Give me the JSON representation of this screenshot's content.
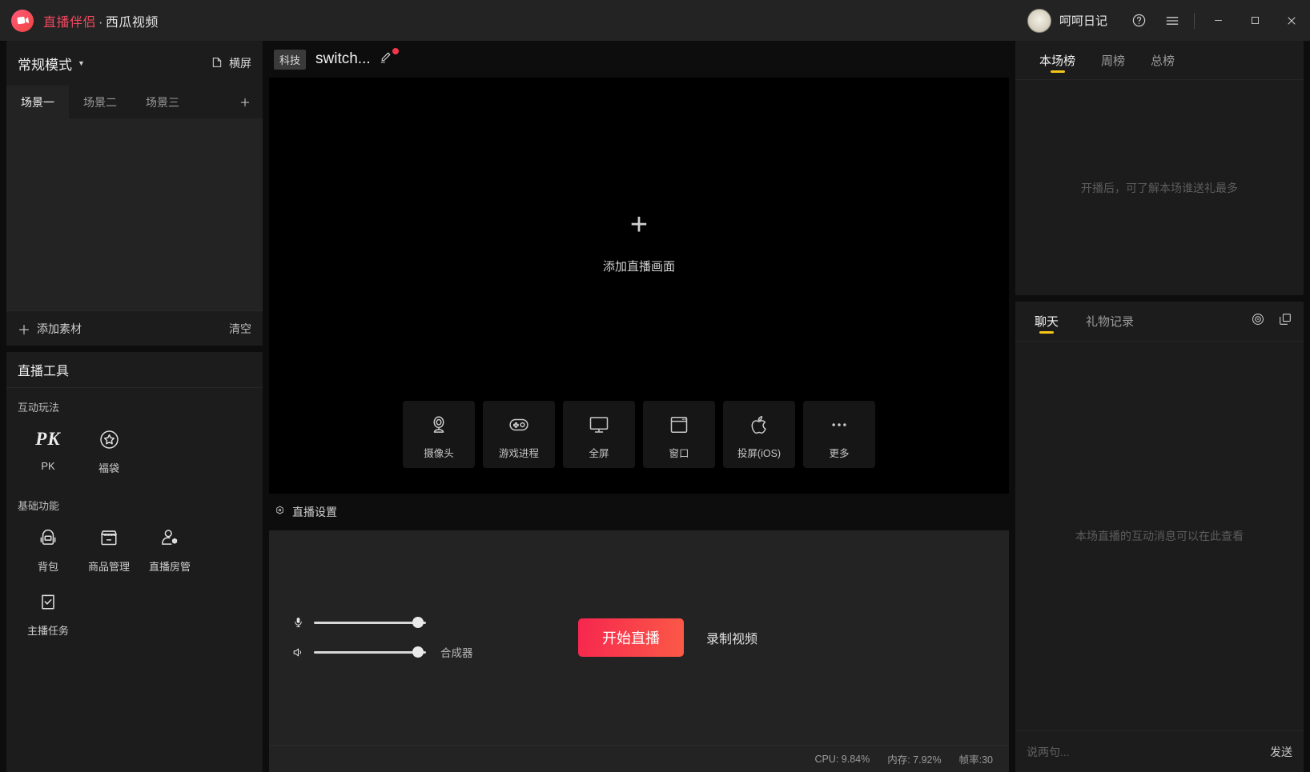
{
  "titlebar": {
    "brand": "直播伴侣",
    "separator": "·",
    "product": "西瓜视频",
    "username": "呵呵日记",
    "help_icon": "help-circle-icon",
    "menu_icon": "hamburger-menu-icon",
    "minimize_icon": "minimize-icon",
    "maximize_icon": "maximize-icon",
    "close_icon": "close-icon",
    "logo_bg": "#f2485e"
  },
  "left_panel": {
    "mode_label": "常规模式",
    "orientation_label": "横屏",
    "scenes": [
      {
        "label": "场景一",
        "active": true
      },
      {
        "label": "场景二",
        "active": false
      },
      {
        "label": "场景三",
        "active": false
      }
    ],
    "add_scene_icon": "plus-icon",
    "add_material_label": "添加素材",
    "clear_label": "清空",
    "tools_title": "直播工具",
    "groups": [
      {
        "label": "互动玩法",
        "items": [
          {
            "label": "PK",
            "icon": "pk-icon"
          },
          {
            "label": "福袋",
            "icon": "star-badge-icon"
          }
        ]
      },
      {
        "label": "基础功能",
        "items": [
          {
            "label": "背包",
            "icon": "backpack-icon"
          },
          {
            "label": "商品管理",
            "icon": "store-icon"
          },
          {
            "label": "直播房管",
            "icon": "user-gear-icon"
          },
          {
            "label": "主播任务",
            "icon": "clipboard-check-icon"
          }
        ]
      }
    ]
  },
  "center": {
    "room_tag": "科技",
    "room_title": "switch...",
    "edit_icon": "pencil-icon",
    "has_edit_badge": true,
    "badge_color": "#f4364c",
    "preview_plus": "+",
    "preview_hint": "添加直播画面",
    "sources": [
      {
        "label": "摄像头",
        "icon": "webcam-icon"
      },
      {
        "label": "游戏进程",
        "icon": "gamepad-icon"
      },
      {
        "label": "全屏",
        "icon": "monitor-icon"
      },
      {
        "label": "窗口",
        "icon": "window-icon"
      },
      {
        "label": "投屏(iOS)",
        "icon": "apple-icon"
      },
      {
        "label": "更多",
        "icon": "more-dots-icon"
      }
    ],
    "settings_label": "直播设置",
    "settings_icon": "gear-icon",
    "mic_icon": "microphone-icon",
    "speaker_icon": "speaker-icon",
    "mic_value": 93,
    "speaker_value": 93,
    "mixer_label": "合成器",
    "go_live_label": "开始直播",
    "record_label": "录制视频",
    "go_live_color": "#f6264e",
    "status": {
      "cpu": "CPU: 9.84%",
      "memory": "内存: 7.92%",
      "fps": "帧率:30"
    }
  },
  "right_panel": {
    "rank_tabs": [
      {
        "label": "本场榜",
        "active": true
      },
      {
        "label": "周榜",
        "active": false
      },
      {
        "label": "总榜",
        "active": false
      }
    ],
    "rank_empty_text": "开播后，可了解本场谁送礼最多",
    "chat_tabs": [
      {
        "label": "聊天",
        "active": true
      },
      {
        "label": "礼物记录",
        "active": false
      }
    ],
    "chat_settings_icon": "target-icon",
    "chat_popout_icon": "popout-window-icon",
    "chat_empty_text": "本场直播的互动消息可以在此查看",
    "chat_placeholder": "说两句...",
    "send_label": "发送",
    "accent_color": "#f5c518"
  }
}
